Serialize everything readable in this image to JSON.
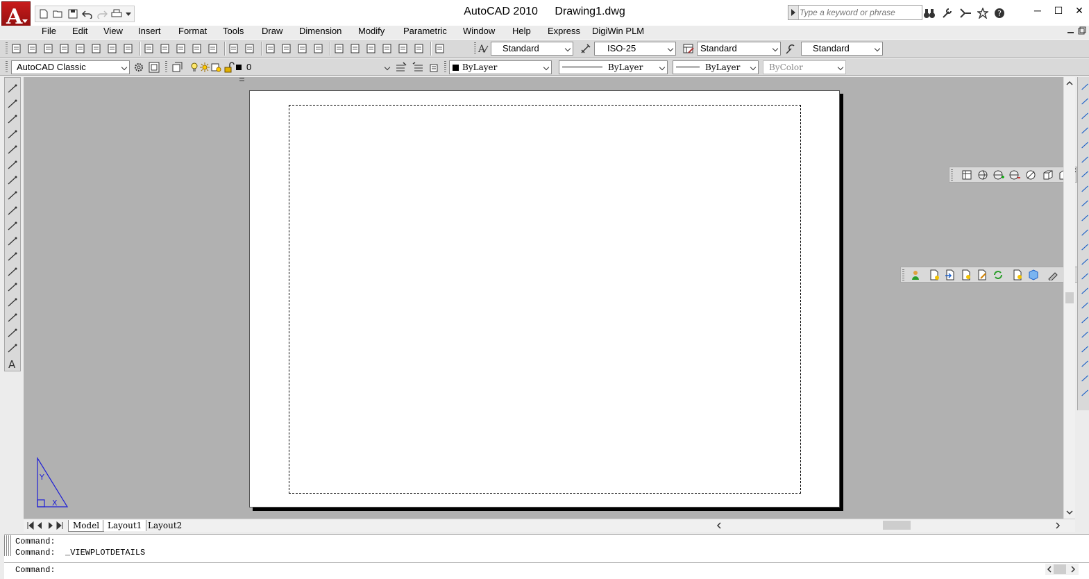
{
  "titlebar": {
    "app_name": "AutoCAD 2010",
    "document_name": "Drawing1.dwg",
    "search_placeholder": "Type a keyword or phrase",
    "minimize": "─",
    "maximize": "☐",
    "close": "✕"
  },
  "menubar": {
    "items": [
      "File",
      "Edit",
      "View",
      "Insert",
      "Format",
      "Tools",
      "Draw",
      "Dimension",
      "Modify",
      "Parametric",
      "Window",
      "Help",
      "Express",
      "DigiWin PLM"
    ]
  },
  "styles_toolbar": {
    "text_style": "Standard",
    "dim_style": "ISO-25",
    "table_style": "Standard",
    "multileader_style": "Standard"
  },
  "layers_toolbar": {
    "workspace": "AutoCAD Classic",
    "current_layer": "0",
    "color": "ByLayer",
    "linetype": "ByLayer",
    "lineweight": "ByLayer",
    "plot_style": "ByColor"
  },
  "tabs": {
    "model": "Model",
    "layout1": "Layout1",
    "layout2": "Layout2"
  },
  "ucs": {
    "y": "Y",
    "x": "X"
  },
  "command": {
    "history": [
      "Command:",
      "Command:  _VIEWPLOTDETAILS"
    ],
    "prompt": "Command:"
  },
  "colors": {
    "canvas_bg": "#b1b1b1",
    "ucs_blue": "#1f1fd6",
    "logo_red": "#c81b1b"
  }
}
